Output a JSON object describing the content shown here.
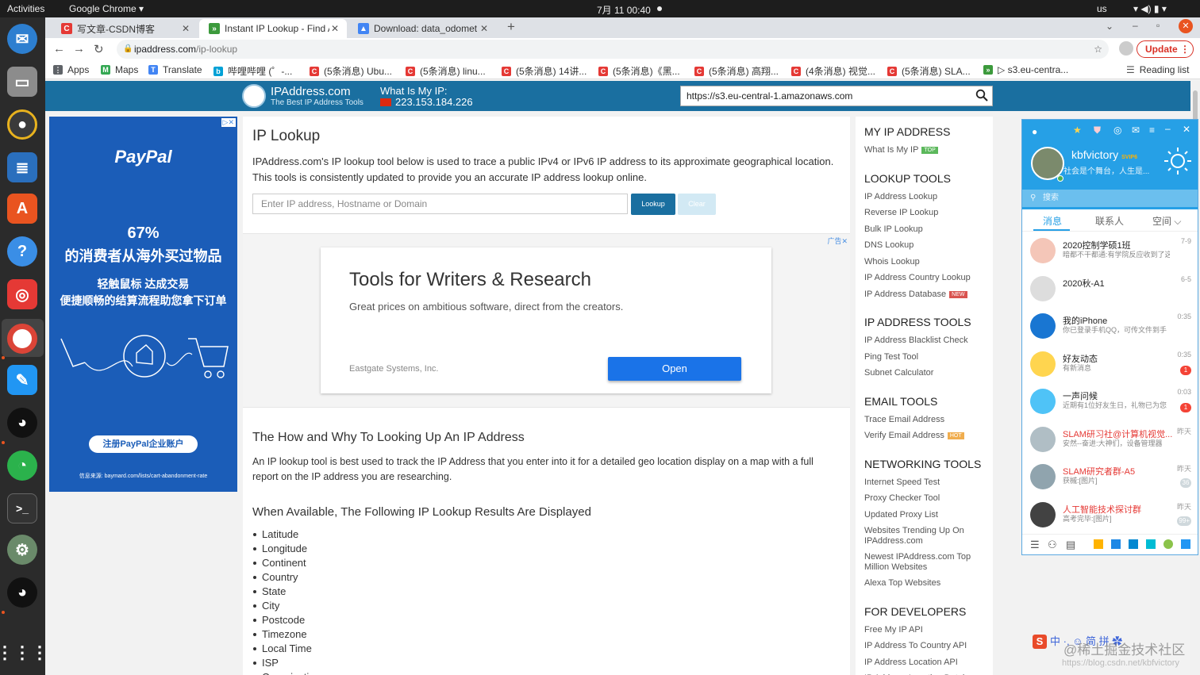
{
  "system": {
    "activities": "Activities",
    "app_menu": "Google Chrome ▾",
    "clock": "7月 11  00:40",
    "keyboard": "us"
  },
  "tabs": [
    {
      "title": "写文章-CSDN博客",
      "favicon_color": "#e53935",
      "favicon_letter": "C"
    },
    {
      "title": "Instant IP Lookup - Find A",
      "favicon_color": "#3c9a3c",
      "favicon_letter": "»"
    },
    {
      "title": "Download: data_odomet",
      "favicon_color": "#4285f4",
      "favicon_letter": "▲"
    }
  ],
  "omnibox": {
    "host": "ipaddress.com",
    "path": "/ip-lookup",
    "update_label": "Update"
  },
  "bookmarks": [
    {
      "label": "Apps",
      "color": "#5f6368",
      "letter": "⋮"
    },
    {
      "label": "Maps",
      "color": "#34a853",
      "letter": "M"
    },
    {
      "label": "Translate",
      "color": "#4285f4",
      "letter": "T"
    },
    {
      "label": "哔哩哔哩 (゜-...",
      "color": "#00a1d6",
      "letter": "b"
    },
    {
      "label": "(5条消息) Ubu...",
      "color": "#e53935",
      "letter": "C"
    },
    {
      "label": "(5条消息) linu...",
      "color": "#e53935",
      "letter": "C"
    },
    {
      "label": "(5条消息) 14讲...",
      "color": "#e53935",
      "letter": "C"
    },
    {
      "label": "(5条消息)《黑...",
      "color": "#e53935",
      "letter": "C"
    },
    {
      "label": "(5条消息) 高翔...",
      "color": "#e53935",
      "letter": "C"
    },
    {
      "label": "(4条消息) 视觉...",
      "color": "#e53935",
      "letter": "C"
    },
    {
      "label": "(5条消息) SLA...",
      "color": "#e53935",
      "letter": "C"
    },
    {
      "label": "▷ s3.eu-centra...",
      "color": "#3c9a3c",
      "letter": "»"
    }
  ],
  "reading_list": "Reading list",
  "header": {
    "site_name": "IPAddress.com",
    "tagline": "The Best IP Address Tools",
    "myip_label": "What Is My IP:",
    "myip_value": "223.153.184.226",
    "search_value": "https://s3.eu-central-1.amazonaws.com"
  },
  "paypal_ad": {
    "logo": "PayPal",
    "percent": "67%",
    "line1": "的消费者从海外买过物品",
    "line2": "轻触鼠标 达成交易",
    "line3": "便捷顺畅的结算流程助您拿下订单",
    "cta": "注册PayPal企业账户",
    "source": "信息来源: baymard.com/lists/cart-abandonment-rate"
  },
  "main": {
    "title": "IP Lookup",
    "intro": "IPAddress.com's IP lookup tool below is used to trace a public IPv4 or IPv6 IP address to its approximate geographical location. This tools is consistently updated to provide you an accurate IP address lookup online.",
    "input_placeholder": "Enter IP address, Hostname or Domain",
    "lookup_label": "Lookup",
    "clear_label": "Clear",
    "ad": {
      "label": "广告✕",
      "title": "Tools for Writers & Research",
      "subtitle": "Great prices on ambitious software, direct from the creators.",
      "company": "Eastgate Systems, Inc.",
      "button": "Open"
    },
    "how_title": "The How and Why To Looking Up An IP Address",
    "how_text": "An IP lookup tool is best used to track the IP Address that you enter into it for a detailed geo location display on a map with a full report on the IP address you are researching.",
    "available_title": "When Available, The Following IP Lookup Results Are Displayed",
    "results": [
      "Latitude",
      "Longitude",
      "Continent",
      "Country",
      "State",
      "City",
      "Postcode",
      "Timezone",
      "Local Time",
      "ISP",
      "Organization"
    ]
  },
  "sidebar": {
    "sections": [
      {
        "heading": "MY IP ADDRESS",
        "links": [
          {
            "label": "What Is My IP",
            "badge": "TOP",
            "badge_color": "#5cb85c"
          }
        ]
      },
      {
        "heading": "LOOKUP TOOLS",
        "links": [
          {
            "label": "IP Address Lookup"
          },
          {
            "label": "Reverse IP Lookup"
          },
          {
            "label": "Bulk IP Lookup"
          },
          {
            "label": "DNS Lookup"
          },
          {
            "label": "Whois Lookup"
          },
          {
            "label": "IP Address Country Lookup"
          },
          {
            "label": "IP Address Database",
            "badge": "NEW",
            "badge_color": "#d9534f"
          }
        ]
      },
      {
        "heading": "IP ADDRESS TOOLS",
        "links": [
          {
            "label": "IP Address Blacklist Check"
          },
          {
            "label": "Ping Test Tool"
          },
          {
            "label": "Subnet Calculator"
          }
        ]
      },
      {
        "heading": "EMAIL TOOLS",
        "links": [
          {
            "label": "Trace Email Address"
          },
          {
            "label": "Verify Email Address",
            "badge": "HOT",
            "badge_color": "#f0ad4e"
          }
        ]
      },
      {
        "heading": "NETWORKING TOOLS",
        "links": [
          {
            "label": "Internet Speed Test"
          },
          {
            "label": "Proxy Checker Tool"
          },
          {
            "label": "Updated Proxy List"
          },
          {
            "label": "Websites Trending Up On IPAddress.com"
          },
          {
            "label": "Newest IPAddress.com Top Million Websites"
          },
          {
            "label": "Alexa Top Websites"
          }
        ]
      },
      {
        "heading": "FOR DEVELOPERS",
        "links": [
          {
            "label": "Free My IP API"
          },
          {
            "label": "IP Address To Country API"
          },
          {
            "label": "IP Address Location API"
          },
          {
            "label": "IP Address Location Database"
          }
        ]
      }
    ]
  },
  "qq": {
    "nickname": "kbfvictory",
    "vip": "SVIP6",
    "signature": "社会是个舞台，人生是...",
    "search_placeholder": "搜索",
    "tabs": [
      "消息",
      "联系人",
      "空间 ⌵"
    ],
    "conversations": [
      {
        "name": "2020控制学硕1班",
        "msg": "暗都不干都通:有学院反应收到了这样",
        "time": "7-9",
        "color": "#f4c6b8",
        "count": "",
        "count_color": ""
      },
      {
        "name": "2020秋-A1",
        "msg": "",
        "time": "6-5",
        "color": "#ddd",
        "count": "",
        "count_color": ""
      },
      {
        "name": "我的iPhone",
        "msg": "你已登录手机QQ，可传文件到手",
        "time": "0:35",
        "color": "#1976d2",
        "count": "",
        "count_color": ""
      },
      {
        "name": "好友动态",
        "msg": "有新消息",
        "time": "0:35",
        "color": "#ffd54f",
        "count": "1",
        "count_color": "#f44336"
      },
      {
        "name": "一声问候",
        "msg": "近期有1位好友生日，礼物已为您",
        "time": "0:03",
        "color": "#4fc3f7",
        "count": "1",
        "count_color": "#f44336"
      },
      {
        "name": "SLAM研习社@计算机视觉...",
        "msg": "安然--奋进:大神们，设备管理器",
        "time": "昨天",
        "color": "#b0bec5",
        "count": "",
        "count_color": ""
      },
      {
        "name": "SLAM研究者群-A5",
        "msg": "获槭:[图片]",
        "time": "昨天",
        "color": "#90a4ae",
        "count": "36",
        "count_color": "#cfd8dc"
      },
      {
        "name": "人工智能技术探讨群",
        "msg": "高考完毕:[图片]",
        "time": "昨天",
        "color": "#424242",
        "count": "99+",
        "count_color": "#cfd8dc"
      }
    ]
  },
  "ime": {
    "logo": "S",
    "text": "中 ·, ☺ 简 拼 ✿"
  },
  "watermark": {
    "line1": "@稀土掘金技术社区",
    "line2": "https://blog.csdn.net/kbfvictory"
  }
}
